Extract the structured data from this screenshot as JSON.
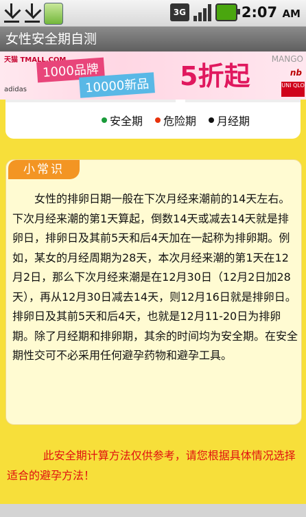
{
  "status_bar": {
    "network": "3G",
    "time": "2:07",
    "ampm": "AM"
  },
  "title_bar": {
    "title": "女性安全期自测"
  },
  "ad_banner": {
    "tmall": "天猫 TMALL.COM",
    "brands_count": "1000品牌",
    "new_items": "10000新品",
    "discount_num": "5",
    "discount_text": "折起",
    "adidas": "adidas",
    "mango": "MANGO",
    "nb": "nb",
    "uniqlo": "UNI QLO"
  },
  "legend": {
    "items": [
      {
        "label": "安全期",
        "color": "#1a9b3a"
      },
      {
        "label": "危险期",
        "color": "#e8320c"
      },
      {
        "label": "月经期",
        "color": "#111111"
      }
    ]
  },
  "tips": {
    "heading": "小常识",
    "body": "女性的排卵日期一般在下次月经来潮前的14天左右。下次月经来潮的第1天算起，倒数14天或减去14天就是排卵日，排卵日及其前5天和后4天加在一起称为排卵期。例如，某女的月经周期为28天，本次月经来潮的第1天在12月2日，那么下次月经来潮是在12月30日（12月2日加28天），再从12月30日减去14天，则12月16日就是排卵日。排卵日及其前5天和后4天，也就是12月11-20日为排卵期。除了月经期和排卵期，其余的时间均为安全期。在安全期性交可不必采用任何避孕药物和避孕工具。"
  },
  "note": "此安全期计算方法仅供参考，请您根据具体情况选择适合的避孕方法！"
}
